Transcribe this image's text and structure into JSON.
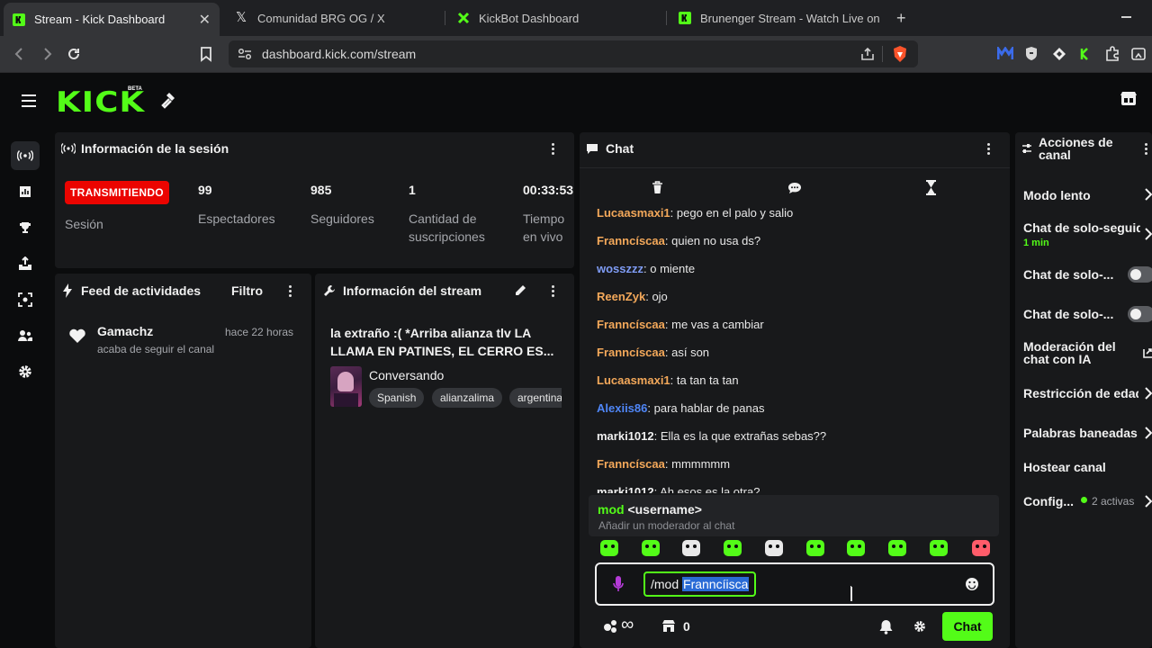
{
  "browser": {
    "tabs": [
      {
        "title": "Stream - Kick Dashboard",
        "active": true
      },
      {
        "title": "Comunidad BRG OG / X",
        "active": false
      },
      {
        "title": "KickBot Dashboard",
        "active": false
      },
      {
        "title": "Brunenger Stream - Watch Live on Ki",
        "active": false
      }
    ],
    "url": "dashboard.kick.com/stream"
  },
  "header": {
    "logo": "KICK",
    "beta": "BETA"
  },
  "session": {
    "title": "Información de la sesión",
    "status_badge": "TRANSMITIENDO",
    "status_label": "Sesión",
    "stats": [
      {
        "value": "99",
        "label": "Espectadores"
      },
      {
        "value": "985",
        "label": "Seguidores"
      },
      {
        "value": "1",
        "label": "Cantidad de suscripciones"
      },
      {
        "value": "00:33:53",
        "label": "Tiempo en vivo"
      }
    ]
  },
  "feed": {
    "title": "Feed de actividades",
    "filter": "Filtro",
    "items": [
      {
        "user": "Gamachz",
        "time": "hace 22 horas",
        "action": "acaba de seguir el canal"
      }
    ]
  },
  "stream_info": {
    "title": "Información del stream",
    "stream_title": "la extraño :( *Arriba alianza tlv LA LLAMA EN PATINES, EL CERRO ES...",
    "category": "Conversando",
    "tags": [
      "Spanish",
      "alianzalima",
      "argentina"
    ]
  },
  "chat": {
    "title": "Chat",
    "messages": [
      {
        "user": "Lucaasmaxi1",
        "text": "pego en el palo y salio",
        "color": "#f3a85a"
      },
      {
        "user": "Franncíscaa",
        "text": "quien no usa ds?",
        "color": "#f3a85a"
      },
      {
        "user": "wosszzz",
        "text": "o miente",
        "color": "#7f9cf5"
      },
      {
        "user": "ReenZyk",
        "text": "ojo",
        "color": "#f3a85a"
      },
      {
        "user": "Franncíscaa",
        "text": "me vas a cambiar",
        "color": "#f3a85a"
      },
      {
        "user": "Franncíscaa",
        "text": "así son",
        "color": "#f3a85a"
      },
      {
        "user": "Lucaasmaxi1",
        "text": "ta tan ta tan",
        "color": "#f3a85a"
      },
      {
        "user": "Alexiis86",
        "text": "para hablar de panas",
        "color": "#4f86f7"
      },
      {
        "user": "marki1012",
        "text": "Ella es la que extrañas sebas??",
        "color": "#f0f0f0"
      },
      {
        "user": "Franncíscaa",
        "text": "mmmmmm",
        "color": "#f3a85a"
      },
      {
        "user": "marki1012",
        "text": "Ah esos es la otra?",
        "color": "#f0f0f0"
      }
    ],
    "suggestion": {
      "command": "mod",
      "arg": "<username>",
      "description": "Añadir un moderador al chat"
    },
    "input": {
      "prefix": "/mod ",
      "selected": "Franncíisca"
    },
    "footer": {
      "infinity": "∞",
      "points": "0",
      "send_label": "Chat"
    }
  },
  "actions": {
    "title": "Acciones de canal",
    "items": [
      {
        "label": "Modo lento",
        "kind": "chevron"
      },
      {
        "label": "Chat de solo-seguidores",
        "sub": "1 min",
        "kind": "chevron"
      },
      {
        "label": "Chat de solo-...",
        "kind": "toggle"
      },
      {
        "label": "Chat de solo-...",
        "kind": "toggle"
      },
      {
        "label": "Moderación del chat con IA",
        "kind": "external"
      },
      {
        "label": "Restricción de edad",
        "kind": "chevron"
      },
      {
        "label": "Palabras baneadas",
        "kind": "chevron"
      },
      {
        "label": "Hostear canal",
        "kind": "none"
      },
      {
        "label": "Config...",
        "sub": "2 activas",
        "kind": "chevron"
      }
    ]
  },
  "colors": {
    "brand": "#53fc18",
    "live": "#eb0400",
    "panel": "#18191b",
    "background": "#0b0c0d"
  }
}
